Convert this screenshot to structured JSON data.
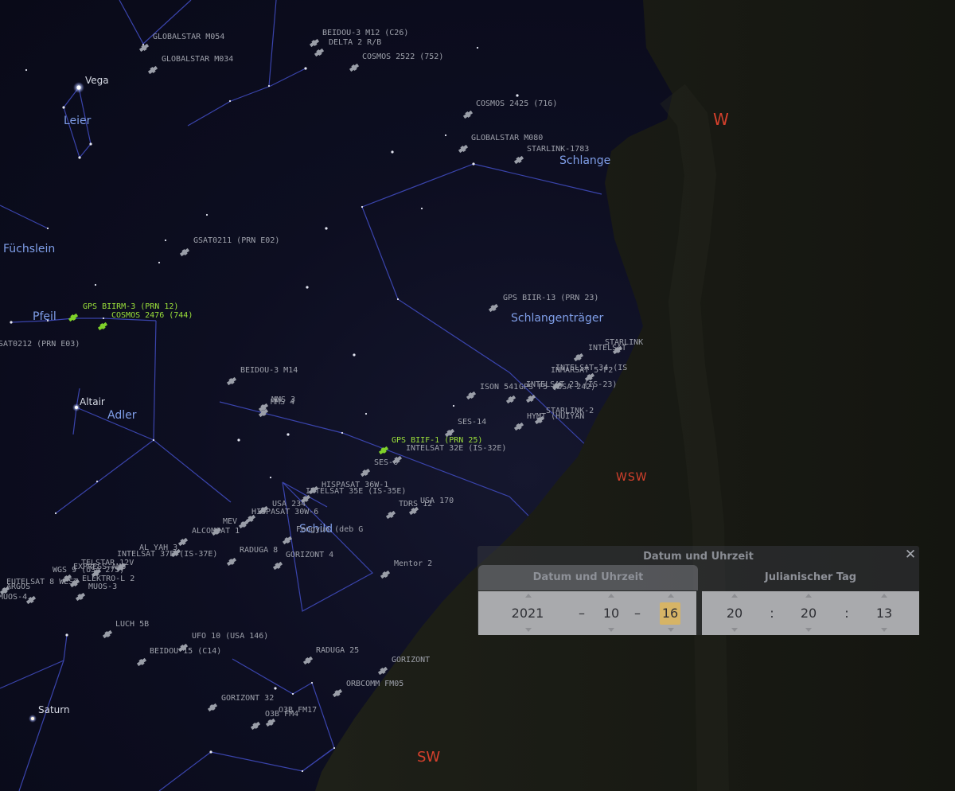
{
  "window": {
    "title": "Stellarium"
  },
  "cardinals": [
    {
      "text": "W"
    },
    {
      "text": "WSW"
    },
    {
      "text": "SW"
    }
  ],
  "constellations": [
    "Leier",
    "Füchslein",
    "Pfeil",
    "Adler",
    "Schlange",
    "Schlangenträger",
    "Schild"
  ],
  "stars": [
    "Vega",
    "Altair",
    "Saturn"
  ],
  "satellites": [
    "GLOBALSTAR M054",
    "GLOBALSTAR M034",
    "BEIDOU-3 M12 (C26)",
    "DELTA 2 R/B",
    "COSMOS 2522 (752)",
    "COSMOS 2425 (716)",
    "GLOBALSTAR M080",
    "STARLINK-1783",
    "GSAT0211 (PRN E02)",
    "GPS BIIRM-3 (PRN 12)",
    "COSMOS 2476 (744)",
    "SAT0212 (PRN E03)",
    "BEIDOU-3 M14",
    "MMS 3",
    "MMS 4",
    "GPS BIIF-1 (PRN 25)",
    "INTELSAT 32E (IS-32E)",
    "SES-6",
    "SES-14",
    "HISPASAT 36W-1",
    "INTELSAT 35E (IS-35E)",
    "USA 234",
    "HISPASAT 30W-6",
    "TDRS 12",
    "USA 170",
    "MEV",
    "ALCOMSAT 1",
    "AL YAH 3",
    "INTELSAT 37E (IS-37E)",
    "RADUGA 8",
    "GORIZONT 4",
    "Mentor 2",
    "TELSTAR 12V",
    "EXPRESS-AM8",
    "WGS 9 (USA 275)",
    "ELEKTRO-L 2",
    "EUTELSAT 8 WEST",
    "MUOS-3",
    "LUCH 5B",
    "UFO 10 (USA 146)",
    "BEIDOU 15 (C14)",
    "RADUGA 25",
    "GORIZONT",
    "ORBCOMM FM05",
    "GORIZONT 32",
    "O3B FM17",
    "O3B FM4",
    "GPS BIIR-13 (PRN 23)",
    "INTELSAT",
    "STARLINK",
    "INTELSAT 34 (IS",
    "INMARSAT 5-F2",
    "INTELSAT 23 (IS-23)",
    "ISON 541",
    "GPS F5 (USA 242)",
    "STARLINK-2",
    "HYMT (HUIYAN",
    "Fengyun (deb G",
    "ARGOS",
    "MUOS-4"
  ],
  "dialog": {
    "title": "Datum und Uhrzeit",
    "close_icon": "close-icon",
    "tabs": [
      {
        "label": "Datum und Uhrzeit",
        "active": true
      },
      {
        "label": "Julianischer Tag",
        "active": false
      }
    ],
    "date": {
      "year": "2021",
      "month": "10",
      "day": "16",
      "separator": "–"
    },
    "time": {
      "hour": "20",
      "minute": "20",
      "second": "13",
      "separator": ":"
    },
    "highlight_color": "#d6b466"
  },
  "colors": {
    "sky": "#0d0e21",
    "constellation_line": "#3c46ae",
    "constellation_label": "#7f9ee8",
    "satellite_label": "#9ea1ab",
    "selected_satellite": "#9be03a",
    "cardinal": "#d4402c"
  }
}
